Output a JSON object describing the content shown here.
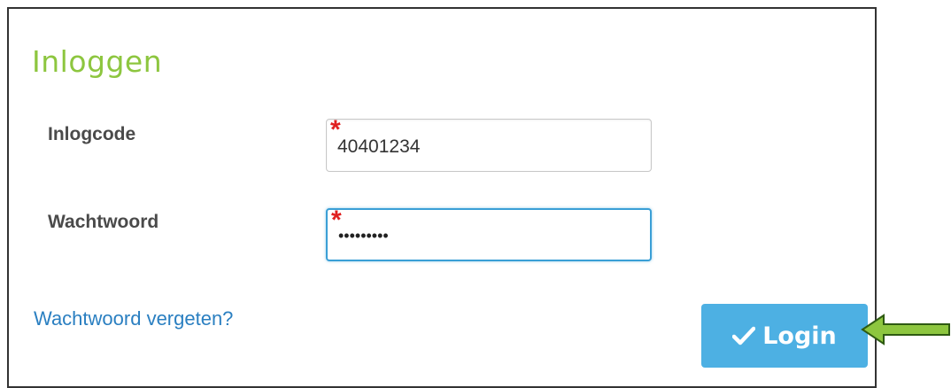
{
  "login_form": {
    "title": "Inloggen",
    "username": {
      "label": "Inlogcode",
      "value": "40401234",
      "required_marker": "*"
    },
    "password": {
      "label": "Wachtwoord",
      "masked_value": "•••••••••",
      "required_marker": "*"
    },
    "forgot_password_link": "Wachtwoord vergeten?",
    "login_button": {
      "label": "Login",
      "icon": "check-icon"
    }
  },
  "annotation": {
    "icon": "arrow-left-icon",
    "color": "#8dc63f"
  },
  "colors": {
    "title": "#8dc63f",
    "link": "#2a7fc1",
    "button_bg": "#4db0e3",
    "required": "#e02020",
    "focus_border": "#3a9fd6"
  }
}
